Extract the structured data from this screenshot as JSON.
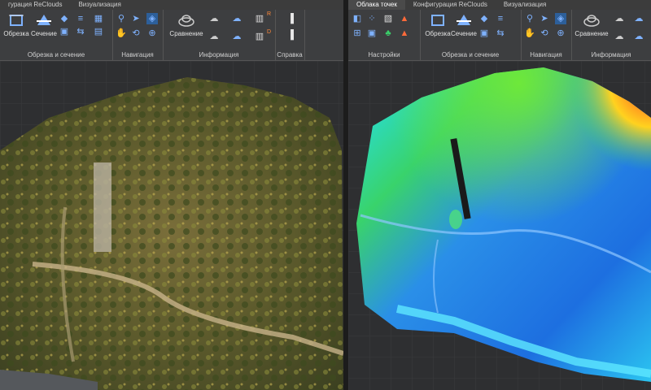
{
  "left": {
    "tabs": [
      "гурация ReClouds",
      "Визуализация"
    ],
    "groups": [
      {
        "label": "Обрезка и сечение"
      },
      {
        "label": "Навигация"
      },
      {
        "label": "Информация"
      },
      {
        "label": "Справка"
      }
    ],
    "buttons": {
      "crop": "Обрезка",
      "section": "Сечение",
      "compare": "Сравнение"
    },
    "badges": {
      "r": "R",
      "d": "D"
    }
  },
  "right": {
    "tabs": [
      "Облака точек",
      "Конфигурация ReClouds",
      "Визуализация"
    ],
    "groups": [
      {
        "label": "Настройки"
      },
      {
        "label": "Обрезка и сечение"
      },
      {
        "label": "Навигация"
      },
      {
        "label": "Информация"
      }
    ],
    "buttons": {
      "crop": "Обрезка",
      "section": "Сечение",
      "compare": "Сравнение"
    }
  },
  "colors": {
    "ribbon_bg": "#3d3e40",
    "accent_blue": "#7fb2ff",
    "heatmap_low": "#22e0ff",
    "heatmap_mid": "#1d6fe0",
    "heatmap_high": "#ff3b1f"
  }
}
